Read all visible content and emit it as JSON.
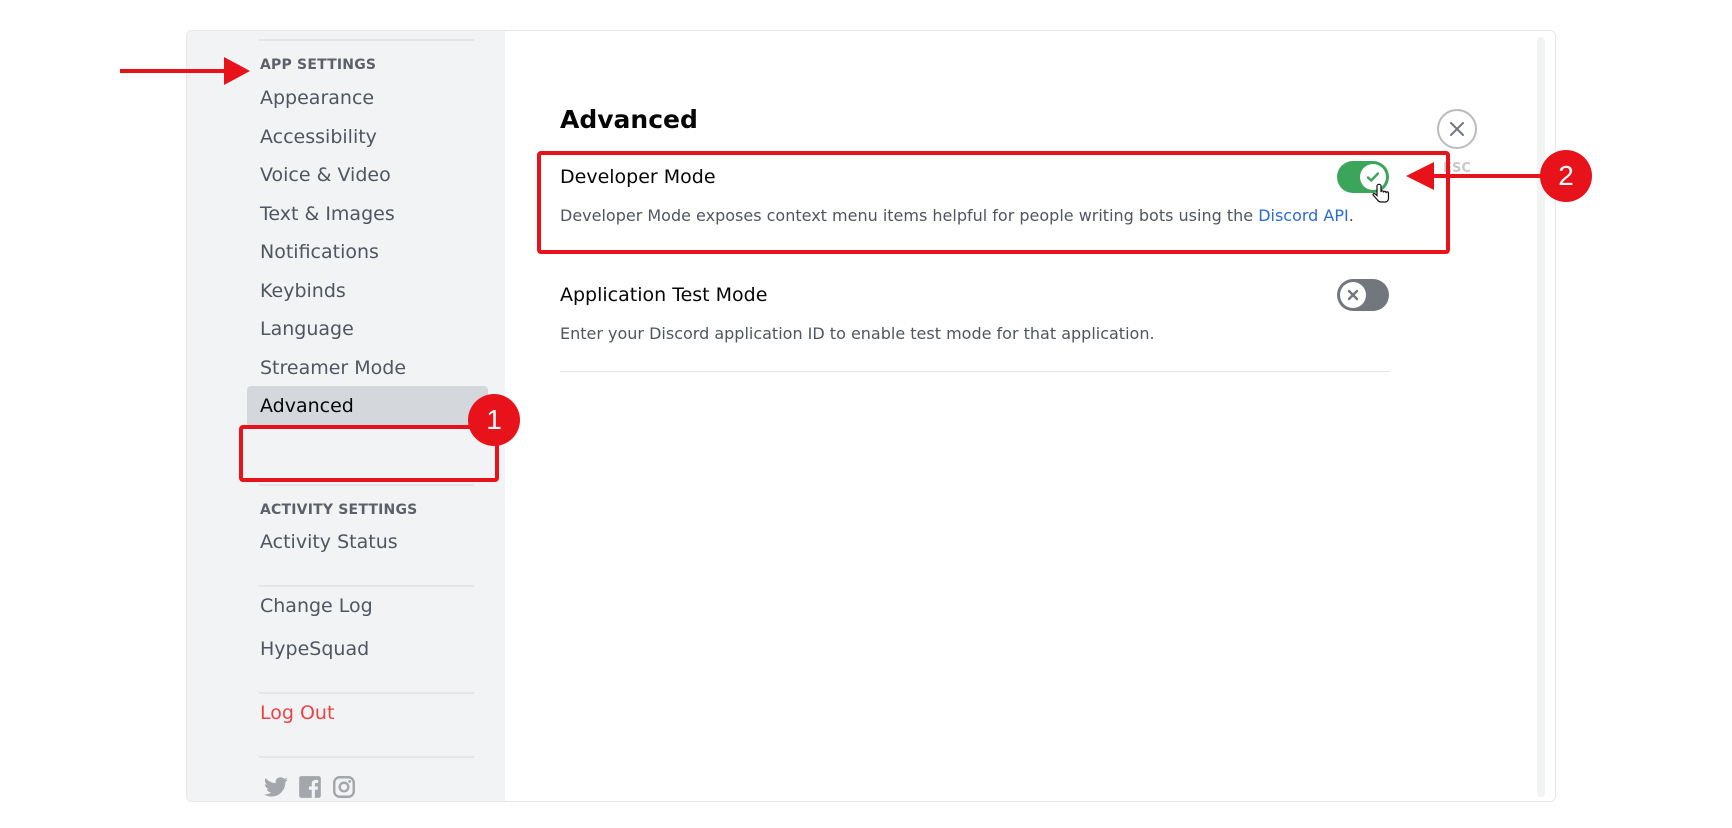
{
  "sidebar": {
    "app_settings_header": "APP SETTINGS",
    "app_items": [
      {
        "label": "Appearance"
      },
      {
        "label": "Accessibility"
      },
      {
        "label": "Voice & Video"
      },
      {
        "label": "Text & Images"
      },
      {
        "label": "Notifications"
      },
      {
        "label": "Keybinds"
      },
      {
        "label": "Language"
      },
      {
        "label": "Streamer Mode"
      },
      {
        "label": "Advanced",
        "selected": true
      }
    ],
    "activity_settings_header": "ACTIVITY SETTINGS",
    "activity_items": [
      {
        "label": "Activity Status"
      }
    ],
    "misc_items": [
      {
        "label": "Change Log"
      },
      {
        "label": "HypeSquad"
      }
    ],
    "logout_label": "Log Out",
    "social_icons": [
      "twitter-icon",
      "facebook-icon",
      "instagram-icon"
    ]
  },
  "main": {
    "title": "Advanced",
    "close_label": "ESC",
    "settings": [
      {
        "title": "Developer Mode",
        "description": "Developer Mode exposes context menu items helpful for people writing bots using the ",
        "link_text": "Discord API",
        "description_end": ".",
        "enabled": true
      },
      {
        "title": "Application Test Mode",
        "description": "Enter your Discord application ID to enable test mode for that application.",
        "enabled": false
      }
    ]
  },
  "annotations": {
    "markers": [
      "1",
      "2"
    ],
    "color": "#e8121b"
  },
  "colors": {
    "sidebar_bg": "#f2f3f5",
    "selected_bg": "#d4d7dc",
    "toggle_on": "#3ba55c",
    "toggle_off": "#72767d",
    "link": "#2a6bd6",
    "logout": "#ed4245"
  }
}
